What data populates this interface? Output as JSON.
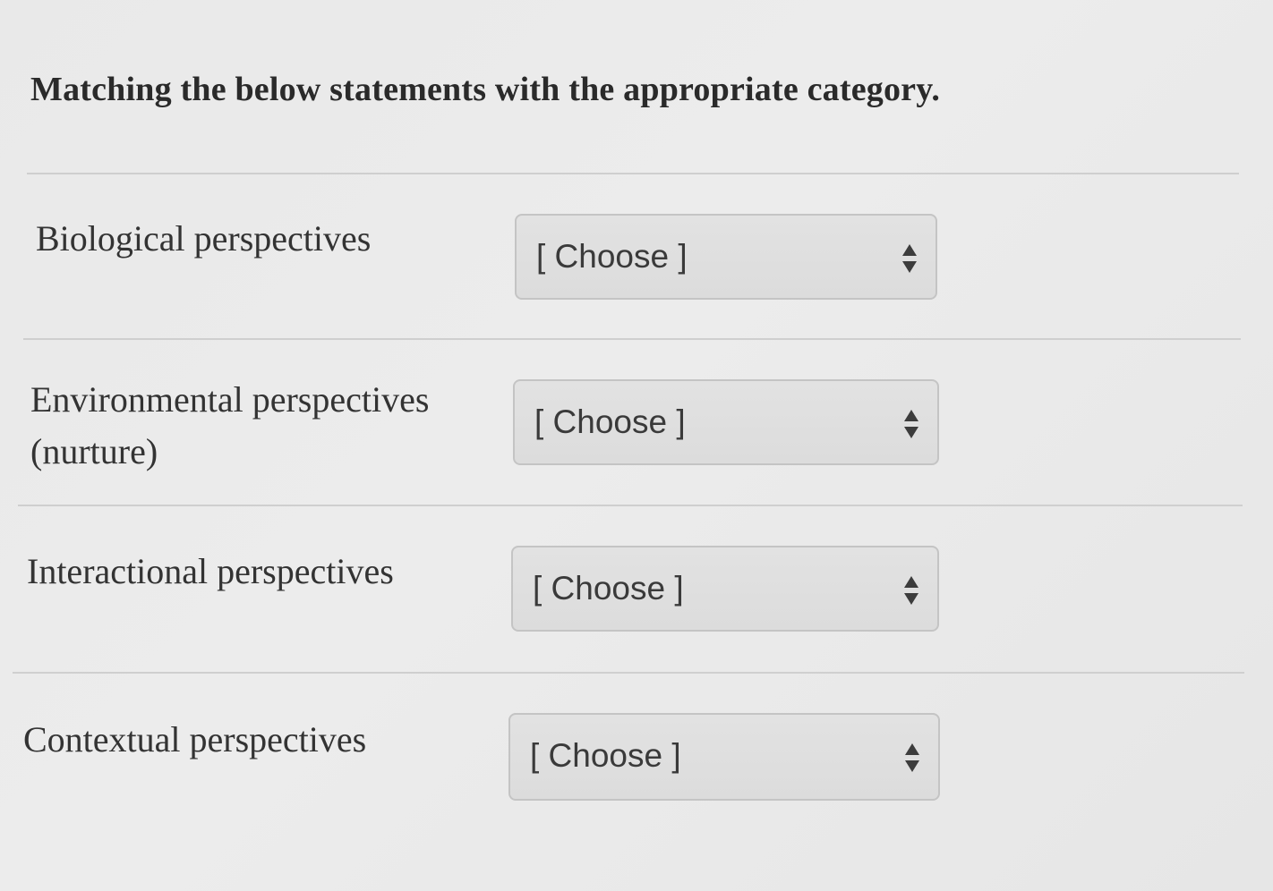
{
  "question": {
    "title": "Matching the below statements with the appropriate category."
  },
  "rows": [
    {
      "label": "Biological perspectives",
      "selected": "[ Choose ]"
    },
    {
      "label": "Environmental perspectives (nurture)",
      "selected": "[ Choose ]"
    },
    {
      "label": "Interactional perspectives",
      "selected": "[ Choose ]"
    },
    {
      "label": "Contextual perspectives",
      "selected": "[ Choose ]"
    }
  ],
  "colors": {
    "background": "#e9e9e9",
    "divider": "#cfcfcf",
    "select_bg": "#dedede",
    "select_border": "#c4c4c4",
    "text": "#333333"
  },
  "icons": {
    "select_arrows": "sort-up-down-icon"
  }
}
